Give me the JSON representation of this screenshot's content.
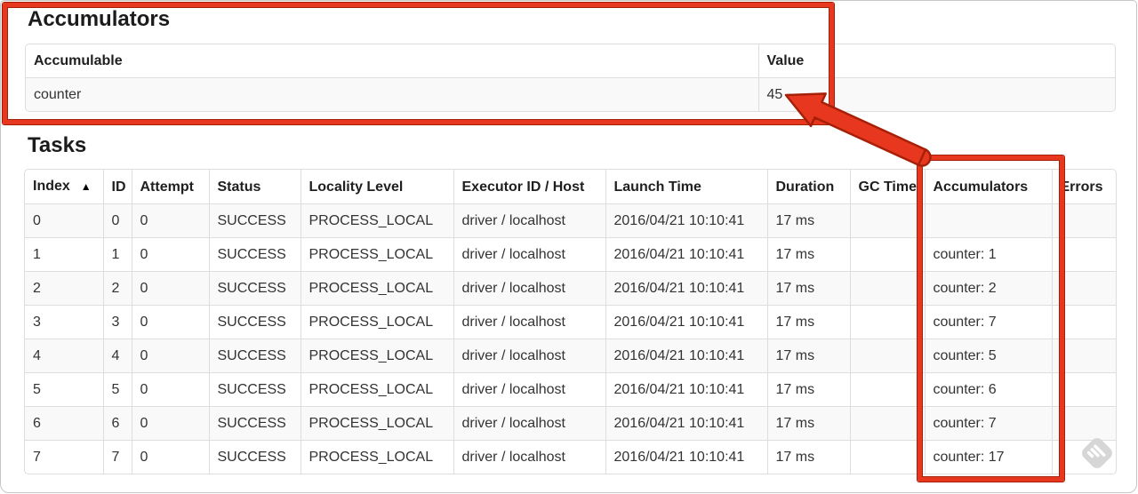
{
  "accumulators_section": {
    "title": "Accumulators",
    "headers": [
      "Accumulable",
      "Value"
    ],
    "rows": [
      {
        "accumulable": "counter",
        "value": "45"
      }
    ]
  },
  "tasks_section": {
    "title": "Tasks",
    "sort_arrow": "▲",
    "headers": [
      "Index",
      "ID",
      "Attempt",
      "Status",
      "Locality Level",
      "Executor ID / Host",
      "Launch Time",
      "Duration",
      "GC Time",
      "Accumulators",
      "Errors"
    ],
    "rows": [
      {
        "index": "0",
        "id": "0",
        "attempt": "0",
        "status": "SUCCESS",
        "locality": "PROCESS_LOCAL",
        "executor": "driver / localhost",
        "launch": "2016/04/21 10:10:41",
        "duration": "17 ms",
        "gc": "",
        "accum": "",
        "errors": ""
      },
      {
        "index": "1",
        "id": "1",
        "attempt": "0",
        "status": "SUCCESS",
        "locality": "PROCESS_LOCAL",
        "executor": "driver / localhost",
        "launch": "2016/04/21 10:10:41",
        "duration": "17 ms",
        "gc": "",
        "accum": "counter: 1",
        "errors": ""
      },
      {
        "index": "2",
        "id": "2",
        "attempt": "0",
        "status": "SUCCESS",
        "locality": "PROCESS_LOCAL",
        "executor": "driver / localhost",
        "launch": "2016/04/21 10:10:41",
        "duration": "17 ms",
        "gc": "",
        "accum": "counter: 2",
        "errors": ""
      },
      {
        "index": "3",
        "id": "3",
        "attempt": "0",
        "status": "SUCCESS",
        "locality": "PROCESS_LOCAL",
        "executor": "driver / localhost",
        "launch": "2016/04/21 10:10:41",
        "duration": "17 ms",
        "gc": "",
        "accum": "counter: 7",
        "errors": ""
      },
      {
        "index": "4",
        "id": "4",
        "attempt": "0",
        "status": "SUCCESS",
        "locality": "PROCESS_LOCAL",
        "executor": "driver / localhost",
        "launch": "2016/04/21 10:10:41",
        "duration": "17 ms",
        "gc": "",
        "accum": "counter: 5",
        "errors": ""
      },
      {
        "index": "5",
        "id": "5",
        "attempt": "0",
        "status": "SUCCESS",
        "locality": "PROCESS_LOCAL",
        "executor": "driver / localhost",
        "launch": "2016/04/21 10:10:41",
        "duration": "17 ms",
        "gc": "",
        "accum": "counter: 6",
        "errors": ""
      },
      {
        "index": "6",
        "id": "6",
        "attempt": "0",
        "status": "SUCCESS",
        "locality": "PROCESS_LOCAL",
        "executor": "driver / localhost",
        "launch": "2016/04/21 10:10:41",
        "duration": "17 ms",
        "gc": "",
        "accum": "counter: 7",
        "errors": ""
      },
      {
        "index": "7",
        "id": "7",
        "attempt": "0",
        "status": "SUCCESS",
        "locality": "PROCESS_LOCAL",
        "executor": "driver / localhost",
        "launch": "2016/04/21 10:10:41",
        "duration": "17 ms",
        "gc": "",
        "accum": "counter: 17",
        "errors": ""
      }
    ]
  },
  "annotations": {
    "highlight_color": "#e8371f",
    "outline_color": "#a62008",
    "arrow_points_to": "45"
  },
  "watermark": {
    "icon": "annotation-app-watermark-icon",
    "color": "#d6d6d6"
  }
}
